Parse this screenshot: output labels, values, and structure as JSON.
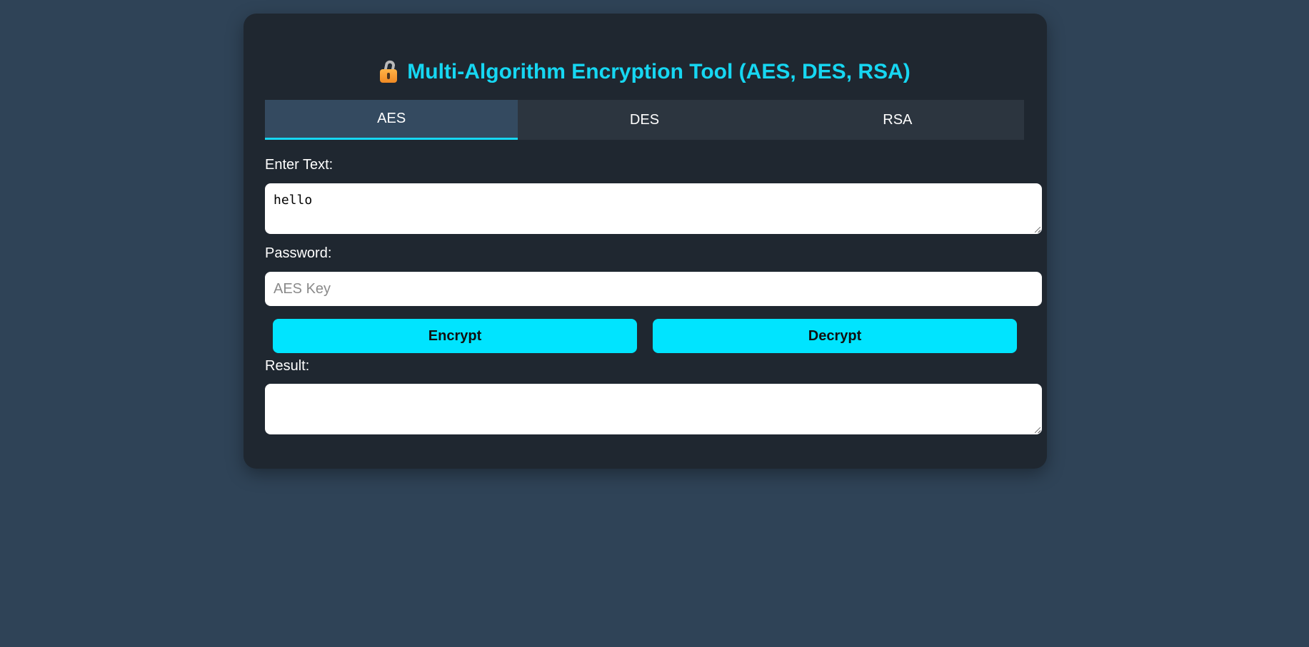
{
  "header": {
    "title": "Multi-Algorithm Encryption Tool (AES, DES, RSA)",
    "icon": "lock-icon"
  },
  "tabs": [
    {
      "label": "AES",
      "active": true
    },
    {
      "label": "DES",
      "active": false
    },
    {
      "label": "RSA",
      "active": false
    }
  ],
  "form": {
    "text_label": "Enter Text:",
    "text_value": "hello",
    "password_label": "Password:",
    "password_placeholder": "AES Key",
    "password_value": "",
    "result_label": "Result:",
    "result_value": ""
  },
  "actions": {
    "encrypt_label": "Encrypt",
    "decrypt_label": "Decrypt"
  },
  "colors": {
    "accent": "#16d7f2",
    "button": "#00e4ff",
    "card": "#1f2730",
    "background": "#2f4357"
  }
}
